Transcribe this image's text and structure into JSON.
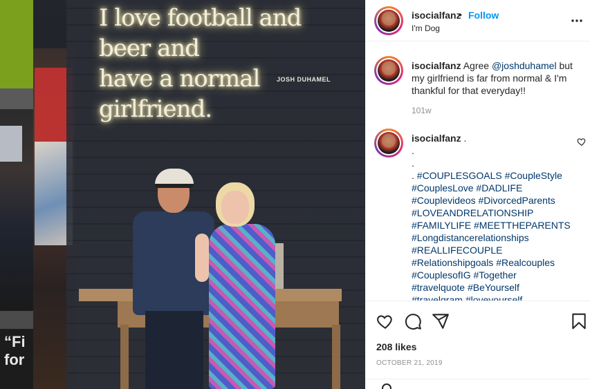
{
  "backdrop": {
    "quote_text": "“Fi\nfor"
  },
  "image": {
    "neon_line1": "I love football and beer and",
    "neon_line2": "have a normal girlfriend.",
    "neon_author": "JOSH DUHAMEL"
  },
  "header": {
    "username": "isocialfanz",
    "separator": "•",
    "follow_label": "Follow",
    "subtitle": "I'm Dog",
    "more_icon": "more-options-icon"
  },
  "caption": {
    "username": "isocialfanz",
    "text_before": " Agree ",
    "mention": "@joshduhamel",
    "text_after": " but my girlfriend is far from normal & I'm thankful for that everyday!!",
    "time": "101w"
  },
  "comment": {
    "username": "isocialfanz",
    "first_line": " .",
    "dot_line1": ".",
    "dot_line2": ".",
    "dot_prefix": ". ",
    "hashtags": [
      "#COUPLESGOALS",
      "#CoupleStyle",
      "#CouplesLove",
      "#DADLIFE",
      "#Couplevideos",
      "#DivorcedParents",
      "#LOVEANDRELATIONSHIP",
      "#FAMILYLIFE",
      "#MEETTHEPARENTS",
      "#Longdistancerelationships",
      "#REALLIFECOUPLE",
      "#Relationshipgoals",
      "#Realcouples",
      "#CouplesofIG",
      "#Together",
      "#travelquote",
      "#BeYourself",
      "#travelgram",
      "#loveyourself"
    ]
  },
  "actions": {
    "like_icon": "heart-icon",
    "comment_icon": "comment-icon",
    "share_icon": "share-icon",
    "save_icon": "bookmark-icon"
  },
  "likes": "208 likes",
  "date": "OCTOBER 21, 2019"
}
